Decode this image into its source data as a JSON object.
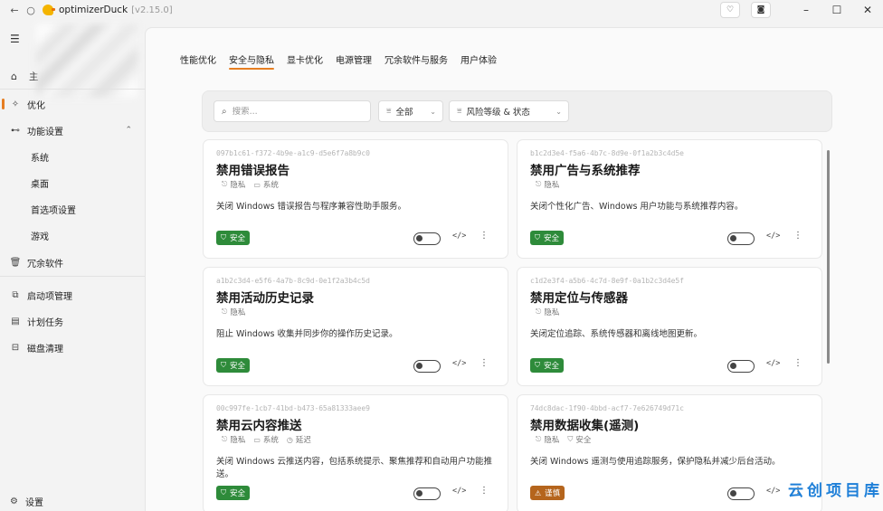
{
  "app": {
    "name": "optimizerDuck",
    "version": "[v2.15.0]"
  },
  "titlebar": {
    "back_icon": "arrow-left-icon",
    "refresh_icon": "circle-icon",
    "heart_icon": "heart-icon",
    "camera_icon": "camera-icon",
    "minimize": "–",
    "maximize": "☐",
    "close": "✕"
  },
  "sidebar": {
    "home_label": "主",
    "items": [
      {
        "label": "优化",
        "icon": "optimize-icon"
      },
      {
        "label": "功能设置",
        "icon": "toggle-icon"
      },
      {
        "label": "系统"
      },
      {
        "label": "桌面"
      },
      {
        "label": "首选项设置"
      },
      {
        "label": "游戏"
      },
      {
        "label": "冗余软件",
        "icon": "trash-icon"
      },
      {
        "label": "启动项管理",
        "icon": "startup-icon"
      },
      {
        "label": "计划任务",
        "icon": "calendar-icon"
      },
      {
        "label": "磁盘清理",
        "icon": "disk-icon"
      }
    ],
    "settings_label": "设置"
  },
  "tabs": [
    "性能优化",
    "安全与隐私",
    "显卡优化",
    "电源管理",
    "冗余软件与服务",
    "用户体验"
  ],
  "active_tab": 1,
  "filters": {
    "search_placeholder": "搜索...",
    "category": "全部",
    "risk": "风险等级 & 状态"
  },
  "cards": [
    {
      "id": "097b1c61-f372-4b9e-a1c9-d5e6f7a8b9c0",
      "title": "禁用错误报告",
      "tags": [
        {
          "icon": "lock-icon",
          "label": "隐私"
        },
        {
          "icon": "monitor-icon",
          "label": "系统"
        }
      ],
      "desc": "关闭 Windows 错误报告与程序兼容性助手服务。",
      "risk": "安全",
      "risk_level": "safe",
      "enabled": false
    },
    {
      "id": "b1c2d3e4-f5a6-4b7c-8d9e-0f1a2b3c4d5e",
      "title": "禁用广告与系统推荐",
      "tags": [
        {
          "icon": "lock-icon",
          "label": "隐私"
        }
      ],
      "desc": "关闭个性化广告、Windows 用户功能与系统推荐内容。",
      "risk": "安全",
      "risk_level": "safe",
      "enabled": false
    },
    {
      "id": "a1b2c3d4-e5f6-4a7b-8c9d-0e1f2a3b4c5d",
      "title": "禁用活动历史记录",
      "tags": [
        {
          "icon": "lock-icon",
          "label": "隐私"
        }
      ],
      "desc": "阻止 Windows 收集并同步你的操作历史记录。",
      "risk": "安全",
      "risk_level": "safe",
      "enabled": false
    },
    {
      "id": "c1d2e3f4-a5b6-4c7d-8e9f-0a1b2c3d4e5f",
      "title": "禁用定位与传感器",
      "tags": [
        {
          "icon": "lock-icon",
          "label": "隐私"
        }
      ],
      "desc": "关闭定位追踪、系统传感器和离线地图更新。",
      "risk": "安全",
      "risk_level": "safe",
      "enabled": false
    },
    {
      "id": "00c997fe-1cb7-41bd-b473-65a81333aee9",
      "title": "禁用云内容推送",
      "tags": [
        {
          "icon": "lock-icon",
          "label": "隐私"
        },
        {
          "icon": "monitor-icon",
          "label": "系统"
        },
        {
          "icon": "clock-icon",
          "label": "延迟"
        }
      ],
      "desc": "关闭 Windows 云推送内容，包括系统提示、聚焦推荐和自动用户功能推送。",
      "risk": "安全",
      "risk_level": "safe",
      "enabled": false
    },
    {
      "id": "74dc8dac-1f90-4bbd-acf7-7e626749d71c",
      "title": "禁用数据收集(遥测)",
      "tags": [
        {
          "icon": "lock-icon",
          "label": "隐私"
        },
        {
          "icon": "shield-icon",
          "label": "安全"
        }
      ],
      "desc": "关闭 Windows 遥测与使用追踪服务，保护隐私并减少后台活动。",
      "risk": "谨慎",
      "risk_level": "caution",
      "enabled": false
    }
  ],
  "colors": {
    "accent": "#e67e22",
    "safe": "#2e8b3a",
    "caution": "#b5651d"
  },
  "watermark": "云创项目库"
}
